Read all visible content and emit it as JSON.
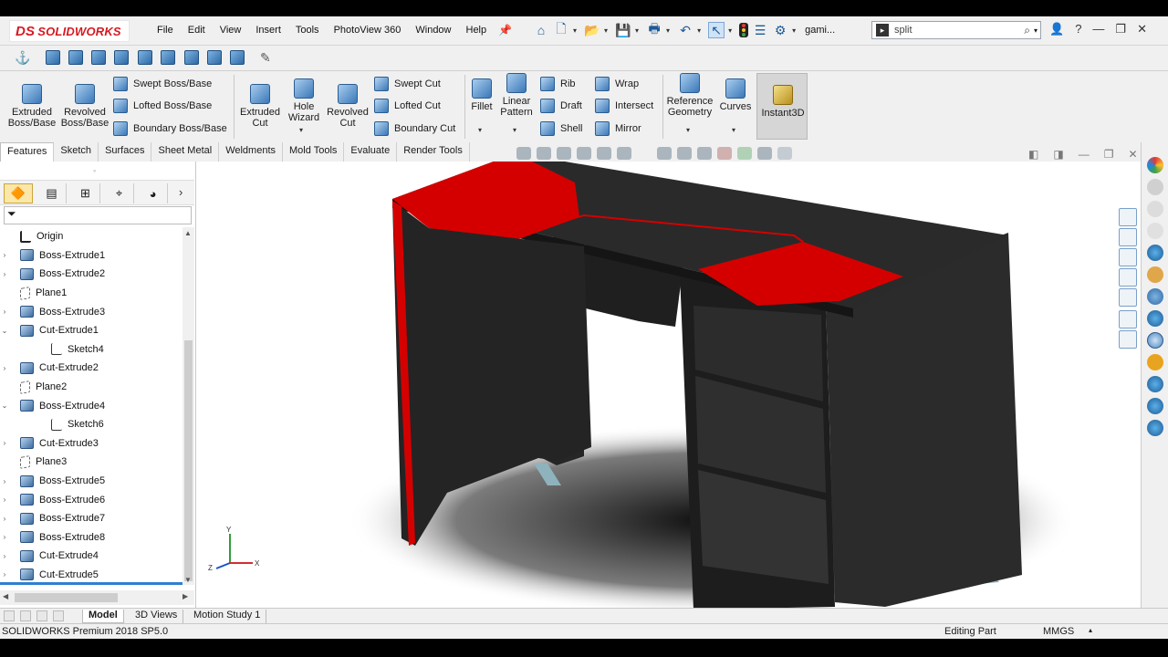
{
  "app": {
    "brand_ds": "DS",
    "brand": "SOLIDWORKS"
  },
  "menu": [
    "File",
    "Edit",
    "View",
    "Insert",
    "Tools",
    "PhotoView 360",
    "Window",
    "Help"
  ],
  "doc_name": "gami...",
  "search": {
    "value": "split"
  },
  "ribbon": {
    "extruded_boss": [
      "Extruded",
      "Boss/Base"
    ],
    "revolved_boss": [
      "Revolved",
      "Boss/Base"
    ],
    "swept_boss": "Swept Boss/Base",
    "lofted_boss": "Lofted Boss/Base",
    "boundary_boss": "Boundary Boss/Base",
    "extruded_cut": [
      "Extruded",
      "Cut"
    ],
    "hole_wizard": [
      "Hole",
      "Wizard"
    ],
    "revolved_cut": [
      "Revolved",
      "Cut"
    ],
    "swept_cut": "Swept Cut",
    "lofted_cut": "Lofted Cut",
    "boundary_cut": "Boundary Cut",
    "fillet": "Fillet",
    "linear_pattern": [
      "Linear",
      "Pattern"
    ],
    "rib": "Rib",
    "draft": "Draft",
    "shell": "Shell",
    "wrap": "Wrap",
    "intersect": "Intersect",
    "mirror": "Mirror",
    "reference_geometry": [
      "Reference",
      "Geometry"
    ],
    "curves": "Curves",
    "instant3d": "Instant3D"
  },
  "tabs": [
    "Features",
    "Sketch",
    "Surfaces",
    "Sheet Metal",
    "Weldments",
    "Mold Tools",
    "Evaluate",
    "Render Tools"
  ],
  "tree": [
    {
      "label": "Origin",
      "type": "origin",
      "expand": ""
    },
    {
      "label": "Boss-Extrude1",
      "type": "feat",
      "expand": "›"
    },
    {
      "label": "Boss-Extrude2",
      "type": "feat",
      "expand": "›"
    },
    {
      "label": "Plane1",
      "type": "plane",
      "expand": ""
    },
    {
      "label": "Boss-Extrude3",
      "type": "feat",
      "expand": "›"
    },
    {
      "label": "Cut-Extrude1",
      "type": "feat",
      "expand": "⌄"
    },
    {
      "label": "Sketch4",
      "type": "sketch",
      "expand": "",
      "child": true
    },
    {
      "label": "Cut-Extrude2",
      "type": "feat",
      "expand": "›"
    },
    {
      "label": "Plane2",
      "type": "plane",
      "expand": ""
    },
    {
      "label": "Boss-Extrude4",
      "type": "feat",
      "expand": "⌄"
    },
    {
      "label": "Sketch6",
      "type": "sketch",
      "expand": "",
      "child": true
    },
    {
      "label": "Cut-Extrude3",
      "type": "feat",
      "expand": "›"
    },
    {
      "label": "Plane3",
      "type": "plane",
      "expand": ""
    },
    {
      "label": "Boss-Extrude5",
      "type": "feat",
      "expand": "›"
    },
    {
      "label": "Boss-Extrude6",
      "type": "feat",
      "expand": "›"
    },
    {
      "label": "Boss-Extrude7",
      "type": "feat",
      "expand": "›"
    },
    {
      "label": "Boss-Extrude8",
      "type": "feat",
      "expand": "›"
    },
    {
      "label": "Cut-Extrude4",
      "type": "feat",
      "expand": "›"
    },
    {
      "label": "Cut-Extrude5",
      "type": "feat",
      "expand": "›"
    }
  ],
  "bottom_tabs": [
    "Model",
    "3D Views",
    "Motion Study 1"
  ],
  "status": {
    "product": "SOLIDWORKS Premium 2018 SP5.0",
    "mode": "Editing Part",
    "units": "MMGS"
  },
  "triad": {
    "x": "X",
    "y": "Y",
    "z": "Z"
  },
  "colors": {
    "accent_red": "#d40000",
    "body_dark": "#2e2e2e",
    "selection_blue": "#2f7fd1"
  }
}
